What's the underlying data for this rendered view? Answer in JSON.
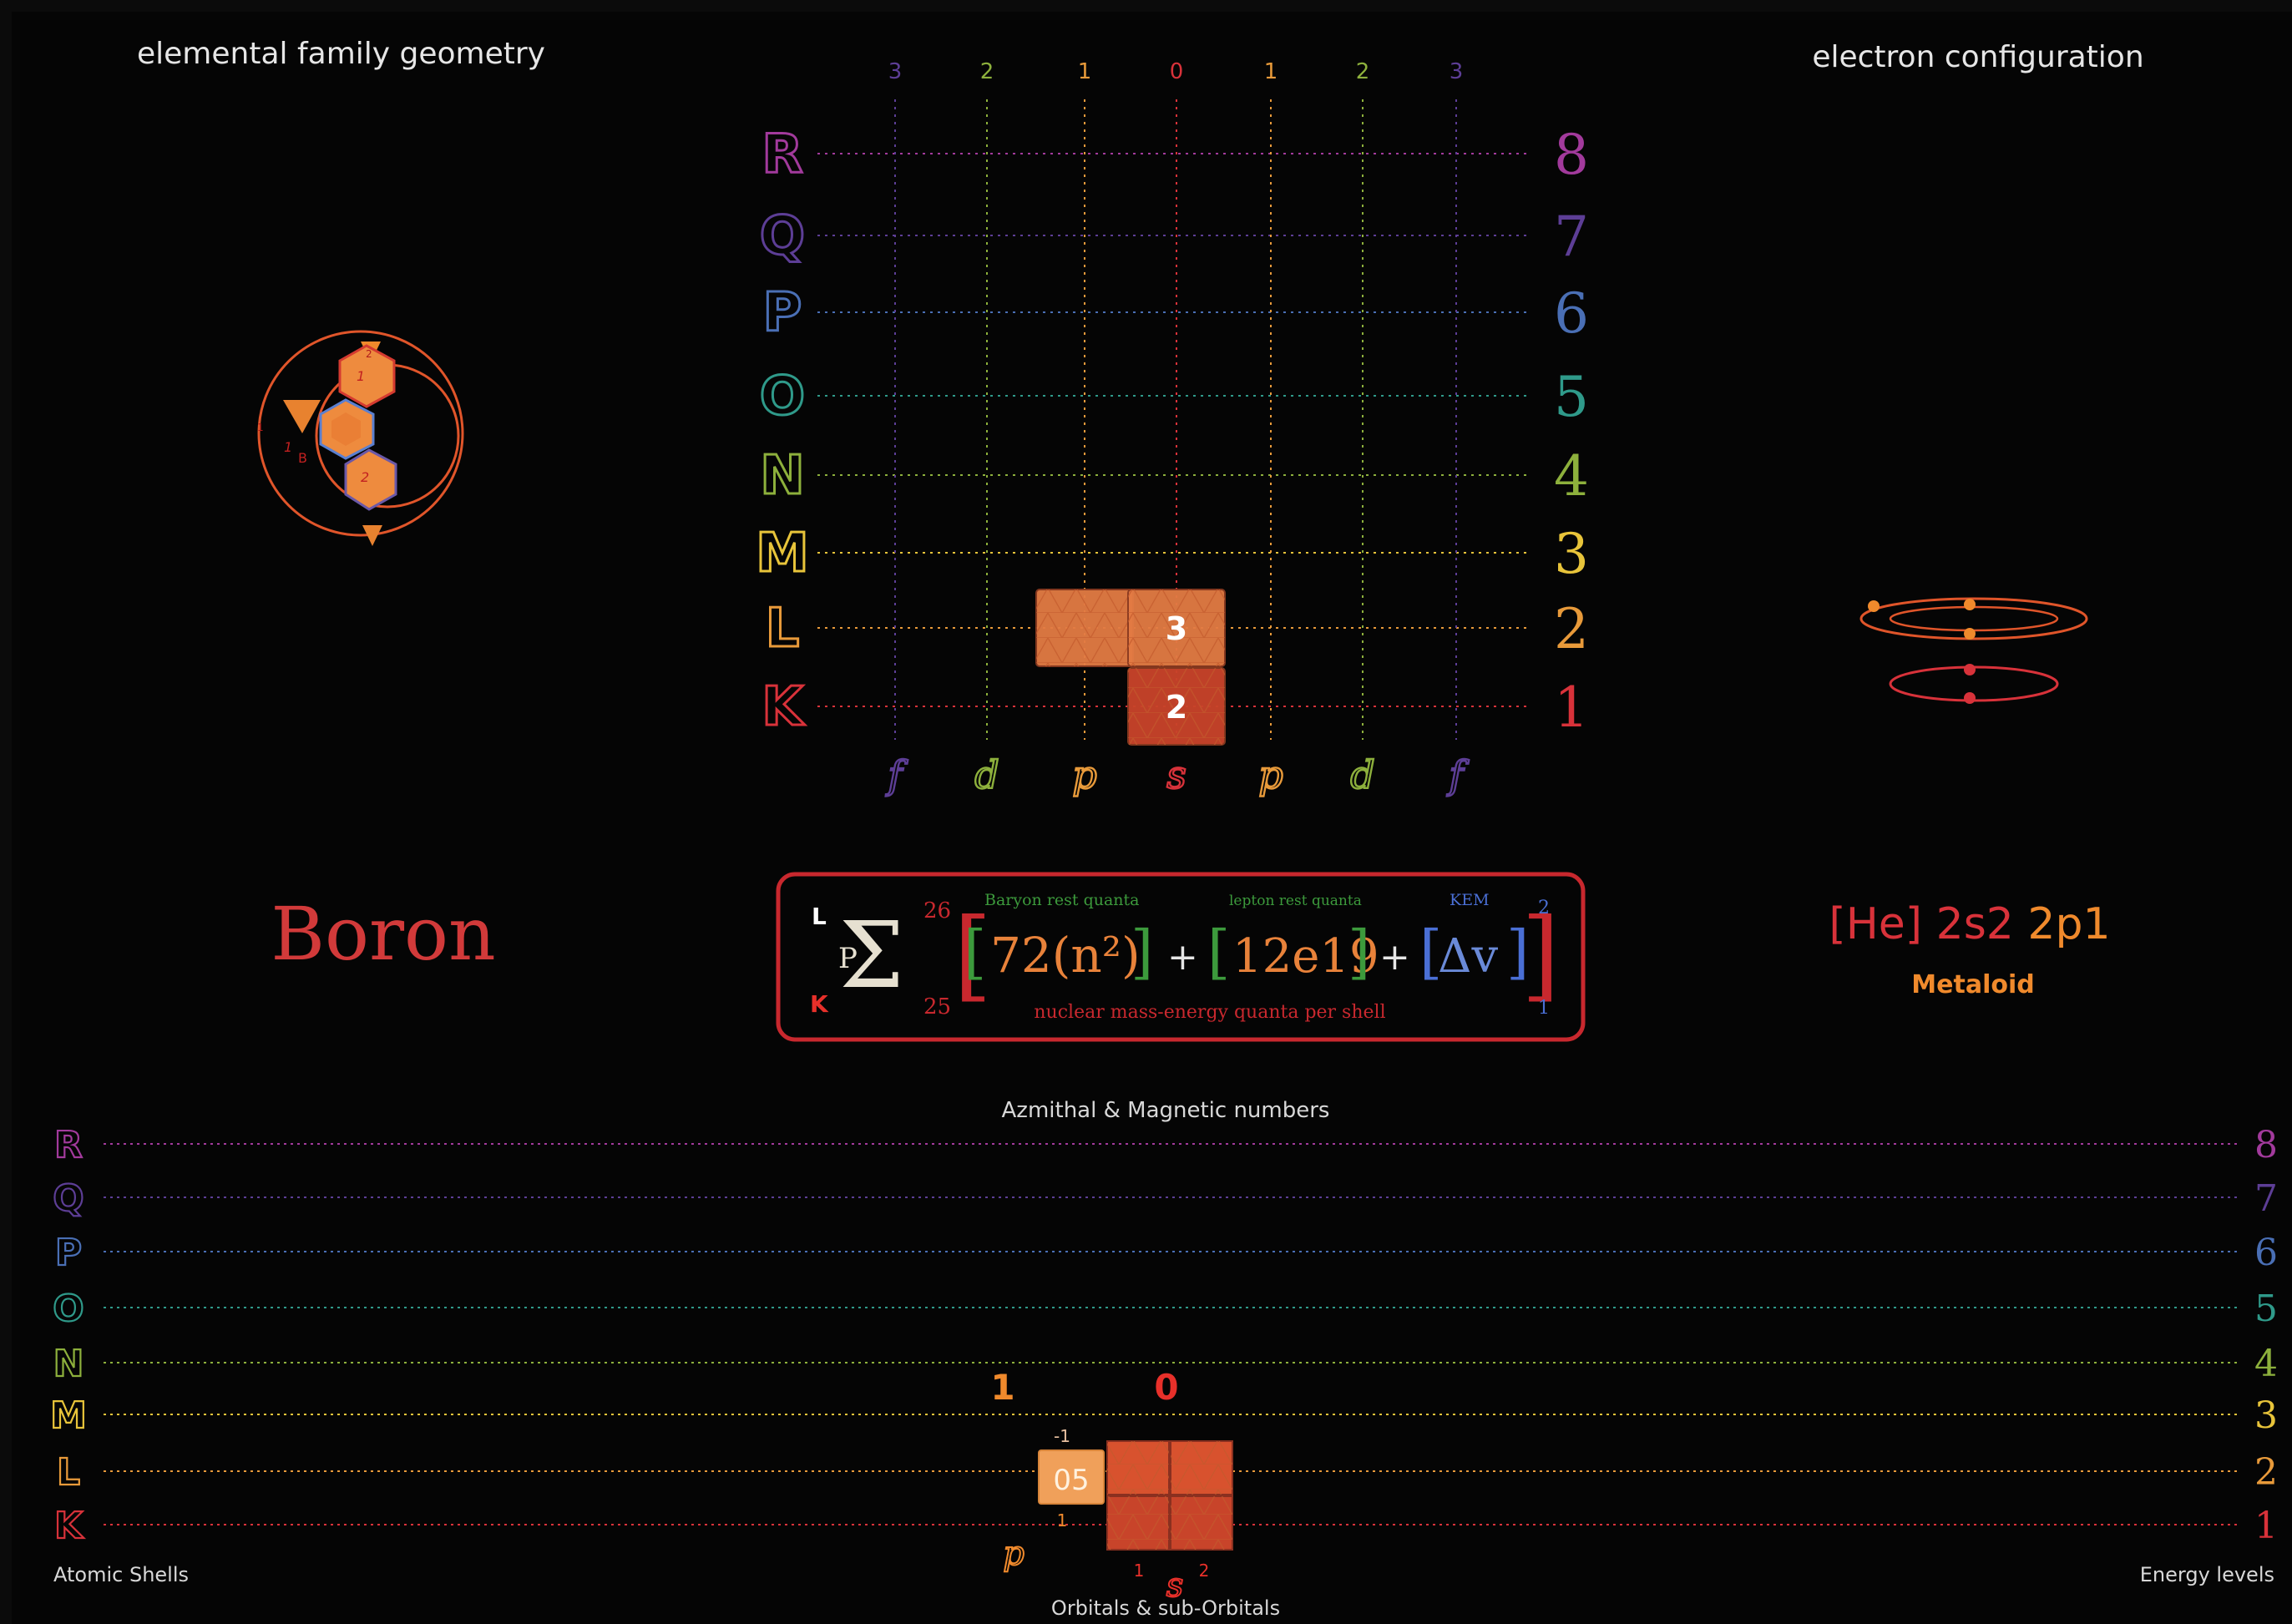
{
  "titles": {
    "geometry": "elemental family geometry",
    "configuration": "electron configuration",
    "azimuthal": "Azmithal & Magnetic numbers",
    "atomic_shells": "Atomic Shells",
    "energy_levels": "Energy levels",
    "orbitals": "Orbitals & sub-Orbitals"
  },
  "element": {
    "name": "Boron",
    "configuration": "[He] 2s2 2p1",
    "configuration_parts": [
      "[He] 2s2",
      " 2p1"
    ],
    "category": "Metaloid"
  },
  "colors": {
    "R": "#a23a9c",
    "Q": "#5d3e96",
    "P": "#4a6fb5",
    "O": "#2f9a8a",
    "N": "#8db03c",
    "M": "#e8c43a",
    "L": "#e89a3a",
    "K": "#d8323a",
    "accent_red": "#d8323a",
    "block_orange": "#e37b44",
    "frame_red": "#c8282e"
  },
  "top_grid": {
    "top_numbers": [
      "3",
      "2",
      "1",
      "0",
      "1",
      "2",
      "3"
    ],
    "bottom_letters": [
      "f",
      "d",
      "p",
      "s",
      "p",
      "d",
      "f"
    ],
    "shell_letters": [
      "R",
      "Q",
      "P",
      "O",
      "N",
      "M",
      "L",
      "K"
    ],
    "level_numbers": [
      "8",
      "7",
      "6",
      "5",
      "4",
      "3",
      "2",
      "1"
    ],
    "occupied": [
      {
        "shell": "L",
        "col": "p",
        "label": ""
      },
      {
        "shell": "L",
        "col": "s",
        "label": "3"
      },
      {
        "shell": "K",
        "col": "s",
        "label": "2"
      }
    ]
  },
  "formula": {
    "upper_limit_shell": "L",
    "lower_limit_shell": "K",
    "index": "P",
    "upper": "26",
    "lower": "25",
    "baryon_label": "Baryon rest quanta",
    "lepton_label": "lepton rest quanta",
    "kem_label": "KEM",
    "term1": "72(n²)",
    "term2": "12e19",
    "term3": "Δv",
    "plus": "+",
    "exp_top": "2",
    "exp_bottom": "1",
    "caption": "nuclear mass-energy quanta per shell"
  },
  "bottom_chart": {
    "shell_letters": [
      "R",
      "Q",
      "P",
      "O",
      "N",
      "M",
      "L",
      "K"
    ],
    "level_numbers": [
      "8",
      "7",
      "6",
      "5",
      "4",
      "3",
      "2",
      "1"
    ],
    "azimuthal_p": "1",
    "azimuthal_s": "0",
    "p_label": "p",
    "s_label": "s",
    "cell_label": "05",
    "m_neg": "-1",
    "m_pos": "1",
    "s_left": "1",
    "s_right": "2"
  },
  "geometry_labels": {
    "top": "2",
    "left": "1",
    "inner1": "1",
    "inner2": "1",
    "inner3": "2",
    "B": "B"
  }
}
